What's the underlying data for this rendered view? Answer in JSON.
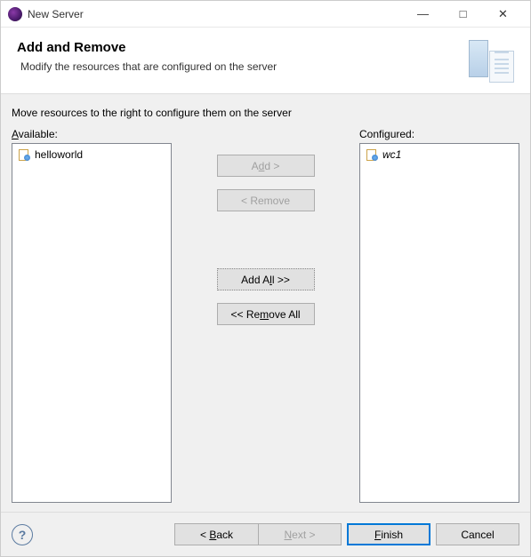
{
  "window": {
    "title": "New Server"
  },
  "header": {
    "title": "Add and Remove",
    "subtitle": "Modify the resources that are configured on the server"
  },
  "content": {
    "instruction": "Move resources to the right to configure them on the server",
    "available_label_pre": "A",
    "available_label_post": "vailable:",
    "configured_label": "Configured:",
    "available_items": [
      "helloworld"
    ],
    "configured_items": [
      "wc1"
    ],
    "buttons": {
      "add_pre": "A",
      "add_u": "d",
      "add_post": "d >",
      "remove": "< Remove",
      "add_all_pre": "Add A",
      "add_all_u": "l",
      "add_all_post": "l >>",
      "remove_all_pre": "<< Re",
      "remove_all_u": "m",
      "remove_all_post": "ove All"
    }
  },
  "footer": {
    "help": "?",
    "back_pre": "< ",
    "back_u": "B",
    "back_post": "ack",
    "next_u": "N",
    "next_post": "ext >",
    "finish_u": "F",
    "finish_post": "inish",
    "cancel": "Cancel"
  }
}
